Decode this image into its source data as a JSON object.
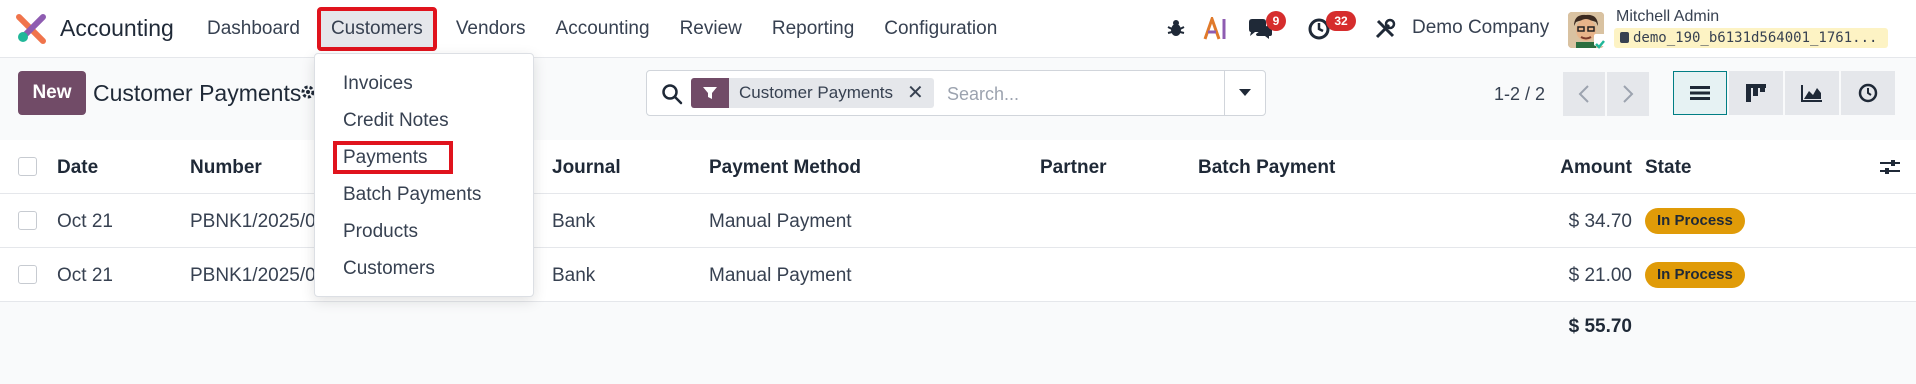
{
  "app": {
    "name": "Accounting"
  },
  "menu": {
    "items": [
      {
        "label": "Dashboard"
      },
      {
        "label": "Customers"
      },
      {
        "label": "Vendors"
      },
      {
        "label": "Accounting"
      },
      {
        "label": "Review"
      },
      {
        "label": "Reporting"
      },
      {
        "label": "Configuration"
      }
    ],
    "active_index": 1
  },
  "systray": {
    "messages_count": "9",
    "activities_count": "32",
    "company": "Demo Company",
    "user_name": "Mitchell Admin",
    "database": "demo_190_b6131d564001_1761..."
  },
  "control": {
    "new_label": "New",
    "title": "Customer Payments",
    "facet_value": "Customer Payments",
    "search_placeholder": "Search...",
    "pager": "1-2 / 2"
  },
  "dropdown": {
    "items": [
      {
        "label": "Invoices"
      },
      {
        "label": "Credit Notes"
      },
      {
        "label": "Payments"
      },
      {
        "label": "Batch Payments"
      },
      {
        "label": "Products"
      },
      {
        "label": "Customers"
      }
    ],
    "highlight_index": 2
  },
  "table": {
    "columns": {
      "date": "Date",
      "number": "Number",
      "journal": "Journal",
      "payment_method": "Payment Method",
      "partner": "Partner",
      "batch_payment": "Batch Payment",
      "amount": "Amount",
      "state": "State"
    },
    "rows": [
      {
        "date": "Oct 21",
        "number": "PBNK1/2025/0",
        "journal": "Bank",
        "payment_method": "Manual Payment",
        "partner": "",
        "batch_payment": "",
        "amount": "$ 34.70",
        "state": "In Process"
      },
      {
        "date": "Oct 21",
        "number": "PBNK1/2025/0",
        "journal": "Bank",
        "payment_method": "Manual Payment",
        "partner": "",
        "batch_payment": "",
        "amount": "$ 21.00",
        "state": "In Process"
      }
    ],
    "total_amount": "$ 55.70"
  },
  "colors": {
    "brand": "#714b67",
    "accent": "#017e84",
    "state_in_process": "#e09b08",
    "badge": "#d62d2d",
    "highlight_outline": "#e0131d"
  }
}
